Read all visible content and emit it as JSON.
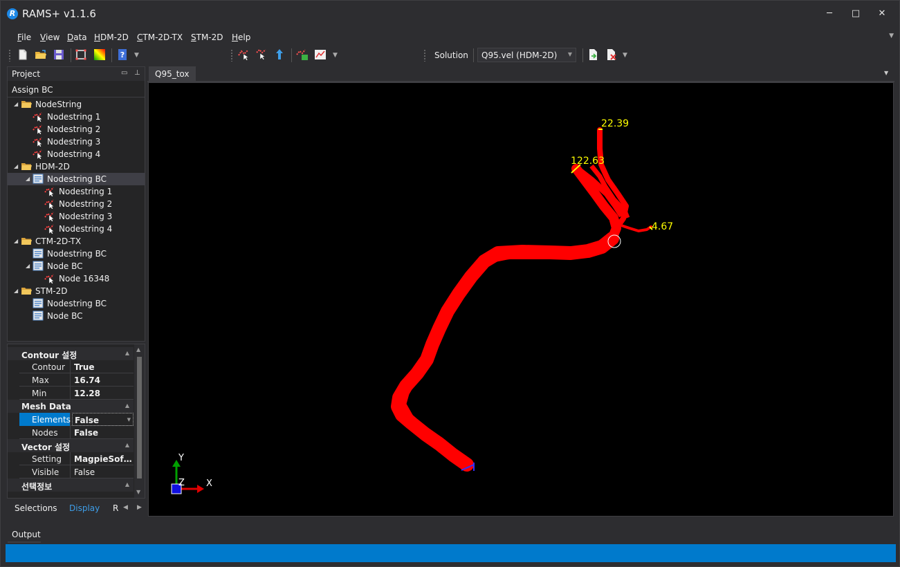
{
  "window": {
    "title": "RAMS+ v1.1.6",
    "logo_letter": "R",
    "controls": {
      "minimize": "─",
      "maximize": "□",
      "close": "✕"
    }
  },
  "menu": [
    {
      "label": "File",
      "accel": "F",
      "rest": "ile"
    },
    {
      "label": "View",
      "accel": "V",
      "rest": "iew"
    },
    {
      "label": "Data",
      "accel": "D",
      "rest": "ata"
    },
    {
      "label": "HDM-2D",
      "accel": "H",
      "rest": "DM-2D"
    },
    {
      "label": "CTM-2D-TX",
      "accel": "C",
      "rest": "TM-2D-TX"
    },
    {
      "label": "STM-2D",
      "accel": "S",
      "rest": "TM-2D"
    },
    {
      "label": "Help",
      "accel": "H",
      "rest": "elp"
    }
  ],
  "toolbar": {
    "solution_label": "Solution",
    "solution_value": "Q95.vel (HDM-2D)",
    "icons": [
      "new-file-icon",
      "open-folder-icon",
      "save-icon",
      "select-region-icon",
      "color-palette-icon",
      "help-book-icon",
      "nodestring-add-icon",
      "nodestring-edit-icon",
      "node-select-icon",
      "nodestring-bc-icon",
      "graph-icon",
      "export-icon",
      "delete-icon"
    ]
  },
  "project_panel": {
    "title": "Project",
    "subheader": "Assign BC",
    "tree": [
      {
        "label": "NodeString",
        "type": "folder",
        "level": 0,
        "expanded": true
      },
      {
        "label": "Nodestring 1",
        "type": "nodestring",
        "level": 1
      },
      {
        "label": "Nodestring 2",
        "type": "nodestring",
        "level": 1
      },
      {
        "label": "Nodestring 3",
        "type": "nodestring",
        "level": 1
      },
      {
        "label": "Nodestring 4",
        "type": "nodestring",
        "level": 1
      },
      {
        "label": "HDM-2D",
        "type": "folder",
        "level": 0,
        "expanded": true
      },
      {
        "label": "Nodestring BC",
        "type": "bc",
        "level": 1,
        "expanded": true,
        "selected": true
      },
      {
        "label": "Nodestring 1",
        "type": "nodestring",
        "level": 2
      },
      {
        "label": "Nodestring 2",
        "type": "nodestring",
        "level": 2
      },
      {
        "label": "Nodestring 3",
        "type": "nodestring",
        "level": 2
      },
      {
        "label": "Nodestring 4",
        "type": "nodestring",
        "level": 2
      },
      {
        "label": "CTM-2D-TX",
        "type": "folder",
        "level": 0,
        "expanded": true
      },
      {
        "label": "Nodestring BC",
        "type": "bc",
        "level": 1
      },
      {
        "label": "Node BC",
        "type": "bc",
        "level": 1,
        "expanded": true
      },
      {
        "label": "Node 16348",
        "type": "nodestring",
        "level": 2
      },
      {
        "label": "STM-2D",
        "type": "folder",
        "level": 0,
        "expanded": true
      },
      {
        "label": "Nodestring BC",
        "type": "bc",
        "level": 1
      },
      {
        "label": "Node BC",
        "type": "bc",
        "level": 1
      }
    ]
  },
  "properties": {
    "categories": [
      {
        "label": "Contour 설정",
        "rows": [
          {
            "name": "Contour",
            "value": "True",
            "bold": true
          },
          {
            "name": "Max",
            "value": "16.74",
            "bold": true
          },
          {
            "name": "Min",
            "value": "12.28",
            "bold": true
          }
        ]
      },
      {
        "label": "Mesh Data",
        "rows": [
          {
            "name": "Elements",
            "value": "False",
            "bold": true,
            "selected": true
          },
          {
            "name": "Nodes",
            "value": "False",
            "bold": true
          }
        ]
      },
      {
        "label": "Vector 설정",
        "rows": [
          {
            "name": "Setting",
            "value": "MagpieSof…",
            "bold": true
          },
          {
            "name": "Visible",
            "value": "False",
            "bold": false
          }
        ]
      },
      {
        "label": "선택정보",
        "rows": []
      }
    ]
  },
  "bottom_tabs": [
    {
      "label": "Selections",
      "active": false
    },
    {
      "label": "Display",
      "active": true
    },
    {
      "label": "R",
      "active": false
    }
  ],
  "document": {
    "tab": "Q95_tox",
    "bc_labels": [
      {
        "text": "22.39"
      },
      {
        "text": "122.63"
      },
      {
        "text": "4.67"
      }
    ],
    "axis": {
      "x": "X",
      "y": "Y",
      "z": "Z"
    },
    "colors": {
      "river": "#ff0000",
      "bc_label": "#ffff00",
      "background": "#000000"
    }
  },
  "output": {
    "label": "Output"
  },
  "colors": {
    "accent": "#007acc",
    "panel": "#252526",
    "chrome": "#2d2d30"
  }
}
